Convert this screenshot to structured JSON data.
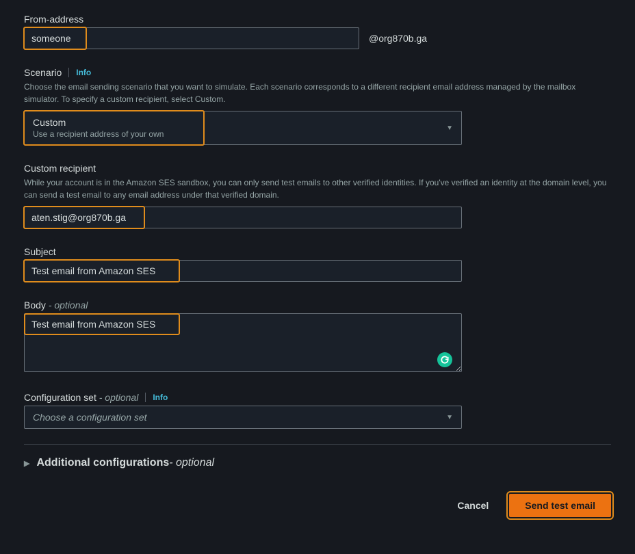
{
  "from": {
    "label": "From-address",
    "value": "someone",
    "domain_suffix": "@org870b.ga"
  },
  "scenario": {
    "label": "Scenario",
    "info": "Info",
    "help": "Choose the email sending scenario that you want to simulate. Each scenario corresponds to a different recipient email address managed by the mailbox simulator. To specify a custom recipient, select Custom.",
    "selected_primary": "Custom",
    "selected_secondary": "Use a recipient address of your own"
  },
  "recipient": {
    "label": "Custom recipient",
    "help": "While your account is in the Amazon SES sandbox, you can only send test emails to other verified identities. If you've verified an identity at the domain level, you can send a test email to any email address under that verified domain.",
    "value": "aten.stig@org870b.ga"
  },
  "subject": {
    "label": "Subject",
    "value": "Test email from Amazon SES"
  },
  "body": {
    "label": "Body",
    "optional": "- optional",
    "value": "Test email from Amazon SES"
  },
  "configset": {
    "label": "Configuration set",
    "optional": "- optional",
    "info": "Info",
    "placeholder": "Choose a configuration set"
  },
  "additional": {
    "label": "Additional configurations",
    "optional": "- optional"
  },
  "footer": {
    "cancel": "Cancel",
    "send": "Send test email"
  }
}
